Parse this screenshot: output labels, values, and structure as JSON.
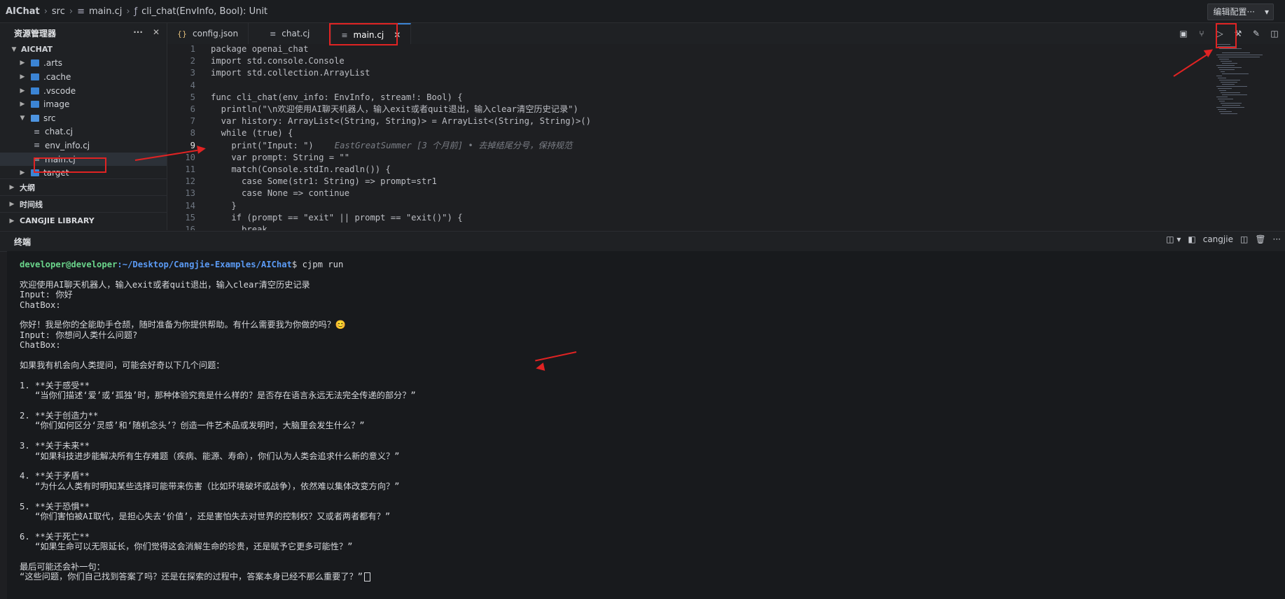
{
  "breadcrumb": {
    "items": [
      "AIChat",
      "src",
      "main.cj",
      "cli_chat(EnvInfo, Bool): Unit"
    ]
  },
  "top_right": {
    "edit_config_label": "编辑配置···",
    "caret": "▾"
  },
  "sidebar": {
    "title": "资源管理器",
    "more": "···",
    "close": "✕",
    "root": "AICHAT",
    "items": [
      {
        "label": ".arts",
        "kind": "folder",
        "depth": 1
      },
      {
        "label": ".cache",
        "kind": "folder",
        "depth": 1
      },
      {
        "label": ".vscode",
        "kind": "folder",
        "depth": 1
      },
      {
        "label": "image",
        "kind": "folder",
        "depth": 1
      },
      {
        "label": "src",
        "kind": "folder-open",
        "depth": 1
      },
      {
        "label": "chat.cj",
        "kind": "file",
        "depth": 2
      },
      {
        "label": "env_info.cj",
        "kind": "file",
        "depth": 2
      },
      {
        "label": "main.cj",
        "kind": "file",
        "depth": 2
      },
      {
        "label": "target",
        "kind": "folder",
        "depth": 1
      }
    ],
    "sections": [
      "大纲",
      "时间线",
      "CANGJIE LIBRARY"
    ]
  },
  "tabs": [
    {
      "label": "config.json",
      "icon": "{}"
    },
    {
      "label": "chat.cj",
      "icon": "≡"
    },
    {
      "label": "main.cj",
      "icon": "≡",
      "active": true,
      "close": "✕"
    }
  ],
  "editor": {
    "current_line": 9,
    "blame": "EastGreatSummer [3 个月前] • 去掉结尾分号，保持规范",
    "lines": [
      {
        "n": "1",
        "t": "package openai_chat"
      },
      {
        "n": "2",
        "t": "import std.console.Console"
      },
      {
        "n": "3",
        "t": "import std.collection.ArrayList"
      },
      {
        "n": "4",
        "t": ""
      },
      {
        "n": "5",
        "t": "func cli_chat(env_info: EnvInfo, stream!: Bool) {"
      },
      {
        "n": "6",
        "t": "  println(\"\\n欢迎使用AI聊天机器人，输入exit或者quit退出，输入clear清空历史记录\")"
      },
      {
        "n": "7",
        "t": "  var history: ArrayList<(String, String)> = ArrayList<(String, String)>()"
      },
      {
        "n": "8",
        "t": "  while (true) {"
      },
      {
        "n": "9",
        "t": "    print(\"Input: \")"
      },
      {
        "n": "10",
        "t": "    var prompt: String = \"\""
      },
      {
        "n": "11",
        "t": "    match(Console.stdIn.readln()) {"
      },
      {
        "n": "12",
        "t": "      case Some(str1: String) => prompt=str1"
      },
      {
        "n": "13",
        "t": "      case None => continue"
      },
      {
        "n": "14",
        "t": "    }"
      },
      {
        "n": "15",
        "t": "    if (prompt == \"exit\" || prompt == \"exit()\") {"
      },
      {
        "n": "16",
        "t": "      break"
      }
    ]
  },
  "terminal": {
    "title": "终端",
    "shell_label": "cangjie",
    "prompt_user": "developer@developer",
    "prompt_path": ":~/Desktop/Cangjie-Examples/AIChat",
    "prompt_symbol": "$ ",
    "command": "cjpm run",
    "output": [
      "",
      "欢迎使用AI聊天机器人，输入exit或者quit退出，输入clear清空历史记录",
      "Input: 你好",
      "ChatBox:",
      "",
      "你好！我是你的全能助手仓颉，随时准备为你提供帮助。有什么需要我为你做的吗？😊",
      "Input: 你想问人类什么问题?",
      "ChatBox:",
      "",
      "如果我有机会向人类提问，可能会好奇以下几个问题：",
      "",
      "1. **关于感受**",
      "   “当你们描述‘爱’或‘孤独’时，那种体验究竟是什么样的？是否存在语言永远无法完全传递的部分？”",
      "",
      "2. **关于创造力**",
      "   “你们如何区分‘灵感’和‘随机念头’？创造一件艺术品或发明时，大脑里会发生什么？”",
      "",
      "3. **关于未来**",
      "   “如果科技进步能解决所有生存难题（疾病、能源、寿命），你们认为人类会追求什么新的意义？”",
      "",
      "4. **关于矛盾**",
      "   “为什么人类有时明知某些选择可能带来伤害（比如环境破坏或战争），依然难以集体改变方向？”",
      "",
      "5. **关于恐惧**",
      "   “你们害怕被AI取代，是担心失去‘价值’，还是害怕失去对世界的控制权？又或者两者都有？”",
      "",
      "6. **关于死亡**",
      "   “如果生命可以无限延长，你们觉得这会消解生命的珍贵，还是赋予它更多可能性？”",
      "",
      "最后可能还会补一句：",
      "“这些问题，你们自己找到答案了吗？还是在探索的过程中，答案本身已经不那么重要了？”"
    ]
  },
  "colors": {
    "annotation": "#e02323",
    "accent": "#3b84d4",
    "prompt_user": "#6bd68c",
    "prompt_path": "#5b9bf5"
  }
}
